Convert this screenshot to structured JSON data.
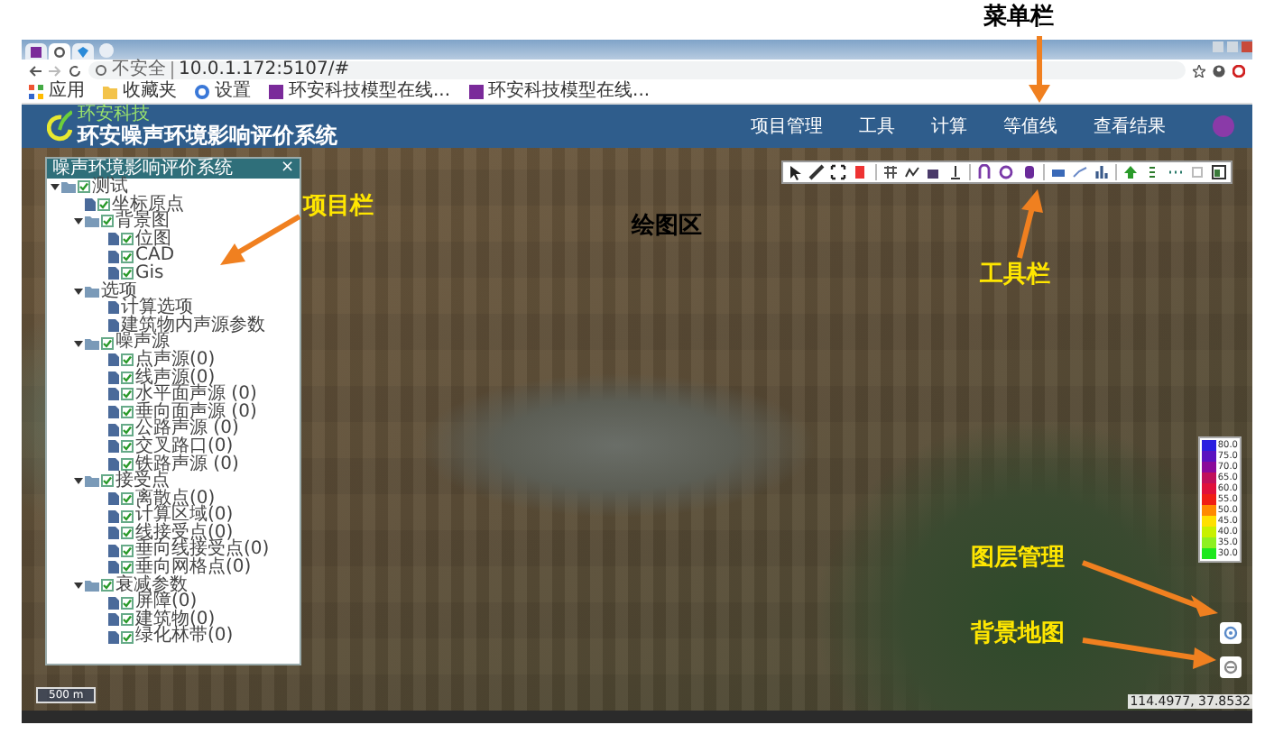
{
  "annotations": {
    "menu_bar": "菜单栏",
    "project_bar": "项目栏",
    "drawing_area": "绘图区",
    "toolbar": "工具栏",
    "layer_management": "图层管理",
    "background_map": "背景地图"
  },
  "browser": {
    "tabs": [
      {
        "selected": false
      },
      {
        "selected": true
      },
      {
        "selected": false
      }
    ],
    "address_prefix": "不安全",
    "address": "10.0.1.172:5107/#",
    "bookmarks": [
      {
        "label": "应用",
        "kind": "apps"
      },
      {
        "label": "收藏夹",
        "kind": "folder"
      },
      {
        "label": "设置",
        "kind": "gear"
      },
      {
        "label": "环安科技模型在线...",
        "kind": "site"
      },
      {
        "label": "环安科技模型在线...",
        "kind": "site"
      }
    ]
  },
  "app": {
    "logo_text": "环安科技",
    "title": "环安噪声环境影响评价系统",
    "menu": [
      {
        "label": "项目管理"
      },
      {
        "label": "工具"
      },
      {
        "label": "计算"
      },
      {
        "label": "等值线"
      },
      {
        "label": "查看结果"
      }
    ]
  },
  "panel": {
    "title": "噪声环境影响评价系统",
    "close": "×",
    "tree": [
      {
        "label": "测试",
        "kind": "check",
        "checked": true,
        "expanded": true,
        "children": [
          {
            "label": "坐标原点",
            "kind": "check",
            "checked": true
          },
          {
            "label": "背景图",
            "kind": "check",
            "checked": true,
            "expanded": true,
            "children": [
              {
                "label": "位图",
                "kind": "check",
                "checked": true
              },
              {
                "label": "CAD",
                "kind": "check",
                "checked": true
              },
              {
                "label": "Gis",
                "kind": "check",
                "checked": true
              }
            ]
          },
          {
            "label": "选项",
            "kind": "plain",
            "expanded": true,
            "children": [
              {
                "label": "计算选项",
                "kind": "plain"
              },
              {
                "label": "建筑物内声源参数",
                "kind": "plain"
              }
            ]
          },
          {
            "label": "噪声源",
            "kind": "check",
            "checked": true,
            "expanded": true,
            "children": [
              {
                "label": "点声源(0)",
                "kind": "check",
                "checked": true
              },
              {
                "label": "线声源(0)",
                "kind": "check",
                "checked": true
              },
              {
                "label": "水平面声源 (0)",
                "kind": "check",
                "checked": true
              },
              {
                "label": "垂向面声源 (0)",
                "kind": "check",
                "checked": true
              },
              {
                "label": "公路声源 (0)",
                "kind": "check",
                "checked": true
              },
              {
                "label": "交叉路口(0)",
                "kind": "check",
                "checked": true
              },
              {
                "label": "铁路声源 (0)",
                "kind": "check",
                "checked": true
              }
            ]
          },
          {
            "label": "接受点",
            "kind": "check",
            "checked": true,
            "expanded": true,
            "children": [
              {
                "label": "离散点(0)",
                "kind": "check",
                "checked": true
              },
              {
                "label": "计算区域(0)",
                "kind": "check",
                "checked": true
              },
              {
                "label": "线接受点(0)",
                "kind": "check",
                "checked": true
              },
              {
                "label": "垂向线接受点(0)",
                "kind": "check",
                "checked": true
              },
              {
                "label": "垂向网格点(0)",
                "kind": "check",
                "checked": true
              }
            ]
          },
          {
            "label": "衰减参数",
            "kind": "check",
            "checked": true,
            "expanded": true,
            "children": [
              {
                "label": "屏障(0)",
                "kind": "check",
                "checked": true
              },
              {
                "label": "建筑物(0)",
                "kind": "check",
                "checked": true
              },
              {
                "label": "绿化林带(0)",
                "kind": "check",
                "checked": true
              }
            ]
          }
        ]
      }
    ]
  },
  "legend": [
    {
      "label": "80.0",
      "color": "#2a1ee0"
    },
    {
      "label": "75.0",
      "color": "#5a12c0"
    },
    {
      "label": "70.0",
      "color": "#8a0a9a"
    },
    {
      "label": "65.0",
      "color": "#c0105a"
    },
    {
      "label": "60.0",
      "color": "#e0103a"
    },
    {
      "label": "55.0",
      "color": "#f01e14"
    },
    {
      "label": "50.0",
      "color": "#ff8a00"
    },
    {
      "label": "45.0",
      "color": "#ffe000"
    },
    {
      "label": "40.0",
      "color": "#c8f000"
    },
    {
      "label": "35.0",
      "color": "#8ef020"
    },
    {
      "label": "30.0",
      "color": "#1ee81e"
    }
  ],
  "scale": "500 m",
  "coordinates": "114.4977, 37.8532"
}
